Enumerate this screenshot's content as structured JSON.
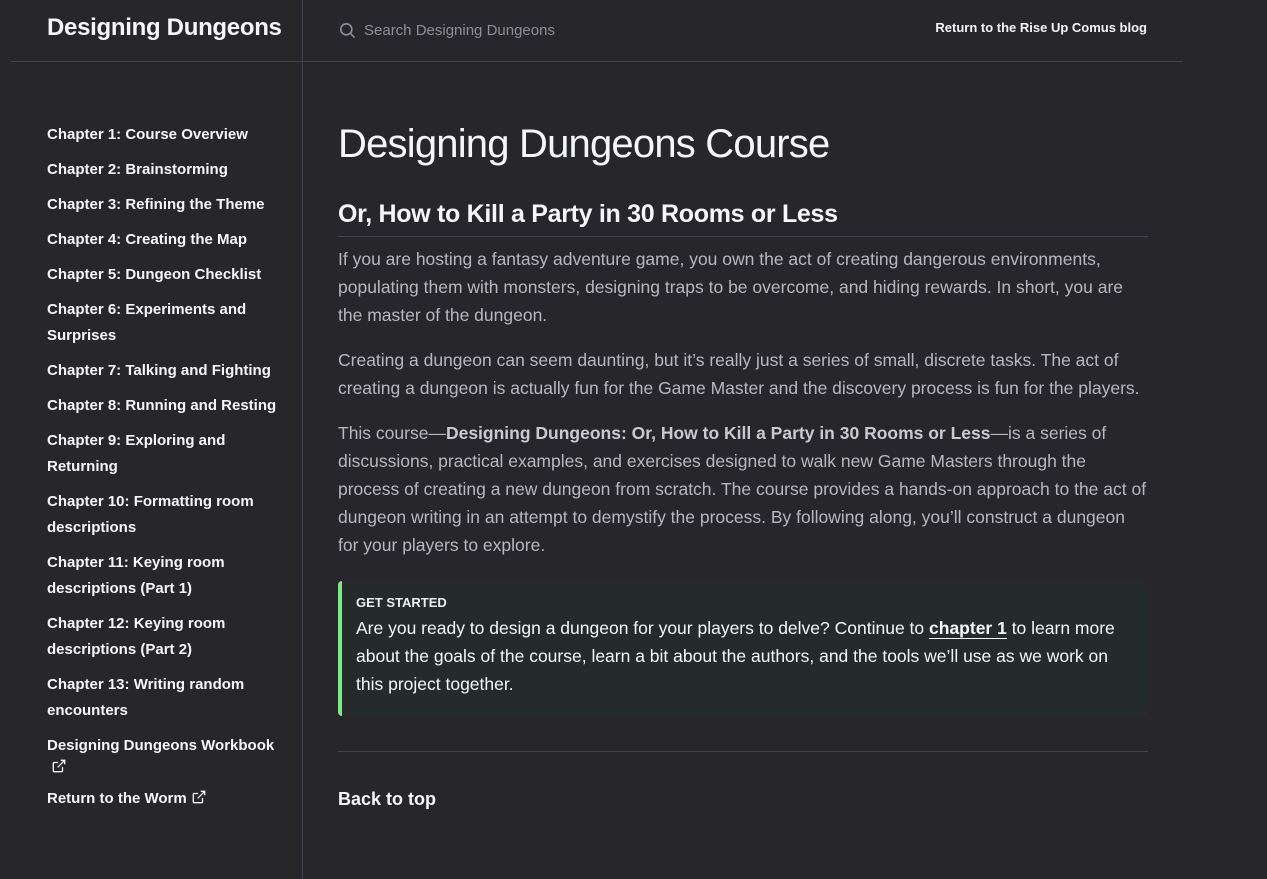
{
  "header": {
    "site_title": "Designing Dungeons",
    "search_placeholder": "Search Designing Dungeons",
    "aux_link": "Return to the Rise Up Comus blog"
  },
  "sidebar": {
    "items": [
      {
        "label": "Chapter 1: Course Overview"
      },
      {
        "label": "Chapter 2: Brainstorming"
      },
      {
        "label": "Chapter 3: Refining the Theme"
      },
      {
        "label": "Chapter 4: Creating the Map"
      },
      {
        "label": "Chapter 5: Dungeon Checklist"
      },
      {
        "label": "Chapter 6: Experiments and Surprises"
      },
      {
        "label": "Chapter 7: Talking and Fighting"
      },
      {
        "label": "Chapter 8: Running and Resting"
      },
      {
        "label": "Chapter 9: Exploring and Returning"
      },
      {
        "label": "Chapter 10: Formatting room descriptions"
      },
      {
        "label": "Chapter 11: Keying room descriptions (Part 1)"
      },
      {
        "label": "Chapter 12: Keying room descriptions (Part 2)"
      },
      {
        "label": "Chapter 13: Writing random encounters"
      },
      {
        "label": "Designing Dungeons Workbook",
        "icon": "external-link-icon"
      },
      {
        "label": "Return to the Worm",
        "icon": "external-link-icon"
      }
    ]
  },
  "main": {
    "title": "Designing Dungeons Course",
    "subtitle": "Or, How to Kill a Party in 30 Rooms or Less",
    "para1": "If you are hosting a fantasy adventure game, you own the act of creating dangerous environments, populating them with monsters, designing traps to be overcome, and hiding rewards. In short, you are the master of the dungeon.",
    "para2": "Creating a dungeon can seem daunting, but it’s really just a series of small, discrete tasks. The act of creating a dungeon is actually fun for the Game Master and the discovery process is fun for the players.",
    "para3_prefix": "This course—",
    "para3_bold": "Designing Dungeons: Or, How to Kill a Party in 30 Rooms or Less",
    "para3_suffix": "—is a series of discussions, practical examples, and exercises designed to walk new Game Masters through the process of creating a new dungeon from scratch. The course provides a hands-on approach to the act of dungeon writing in an attempt to demystify the process. By following along, you’ll construct a dungeon for your players to explore.",
    "callout": {
      "title": "GET STARTED",
      "text_before": "Are you ready to design a dungeon for your players to delve? Continue to ",
      "link": "chapter 1",
      "text_after": " to learn more about the goals of the course, learn a bit about the authors, and the tools we’ll use as we work on this project together."
    },
    "back_to_top": "Back to top"
  },
  "colors": {
    "background": "#27262b",
    "text": "#f5f6fa",
    "body_text": "#b8b7be",
    "callout_accent": "#7ee787",
    "callout_bg": "#252a2a"
  },
  "icons": {
    "search": "search-icon",
    "external": "external-link-icon"
  }
}
